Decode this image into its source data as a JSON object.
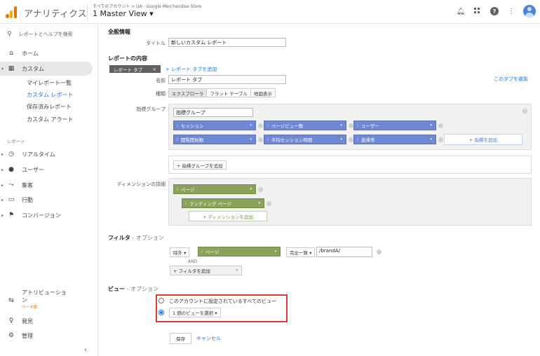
{
  "header": {
    "app_name": "アナリティクス",
    "breadcrumb": "すべてのアカウント > UA - Google Merchandise Store",
    "view": "1 Master View ▾"
  },
  "sidebar": {
    "search": "レポートとヘルプを検索",
    "home": "ホーム",
    "custom": "カスタム",
    "custom_items": [
      "マイレポート一覧",
      "カスタム レポート",
      "保存済みレポート",
      "カスタム アラート"
    ],
    "reports_label": "レポート",
    "report_items": [
      "リアルタイム",
      "ユーザー",
      "集客",
      "行動",
      "コンバージョン"
    ],
    "attribution": "アトリビューショ",
    "attribution_2": "ン",
    "beta": "ベータ版",
    "discover": "発見",
    "admin": "管理"
  },
  "general": {
    "heading": "全般情報",
    "title_label": "タイトル",
    "title_value": "新しいカスタム レポート"
  },
  "content": {
    "heading": "レポートの内容",
    "tab_chip": "レポート タブ",
    "add_tab": "+ レポート タブを追加",
    "copy_tab": "このタブを複製",
    "name_label": "名前",
    "name_value": "レポート タブ",
    "type_label": "種類",
    "types": [
      "エクスプローラ",
      "フラット テーブル",
      "地図表示"
    ],
    "metric_group_label": "指標グループ",
    "metric_group_name": "指標グループ",
    "metrics_row1": [
      "セッション",
      "ページビュー数",
      "ユーザー"
    ],
    "metrics_row2": [
      "閲覧開始数",
      "平均セッション時間",
      "直帰率"
    ],
    "add_metric": "+ 指標を追加",
    "add_metric_group": "+ 指標グループを追加",
    "dimension_label": "ディメンションの詳細",
    "dimension_1": "ページ",
    "dimension_2": "ランディング ページ",
    "add_dimension": "+ ディメンションを追加"
  },
  "filter": {
    "heading": "フィルタ",
    "optional": " - オプション",
    "exclude": "除外 ▾",
    "dimension": "ページ",
    "match": "完全一致 ▾",
    "value": "/brandA/",
    "and": "AND",
    "add_filter": "+ フィルタを追加"
  },
  "view_section": {
    "heading": "ビュー",
    "optional": " - オプション",
    "option_all": "このアカウントに設定されているすべてのビュー",
    "select_one": "1 個のビューを選択 ▾"
  },
  "actions": {
    "save": "保存",
    "cancel": "キャンセル"
  }
}
